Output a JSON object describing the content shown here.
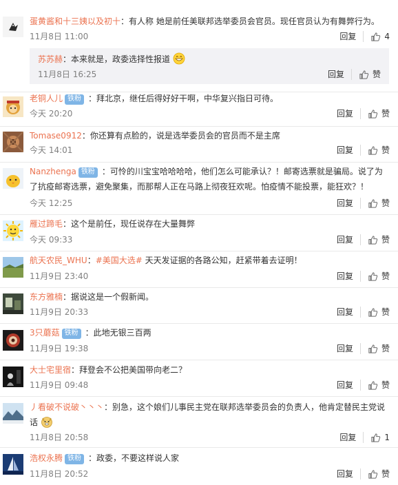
{
  "labels": {
    "reply": "回复",
    "like": "赞",
    "sep": "："
  },
  "colors": {
    "username": "#eb7350",
    "badge_bg": "#7fb5e6",
    "tag": "#eb7350",
    "time": "#808080"
  },
  "comments": [
    {
      "user": "蛋黄酱和十三姨以及初十",
      "badge": "",
      "text": "有人称 她是前任美联邦选举委员会官员。现任官员认为有舞弊行为。",
      "time": "11月8日 11:00",
      "like_count": "4",
      "avatar_icon": "bird-avatar",
      "reply": {
        "user": "苏苏赫",
        "text": "本来就是，政委选择性报道",
        "emoji": "grin-emoji",
        "time": "11月8日 16:25",
        "like_label": "赞"
      }
    },
    {
      "user": "老铜人儿",
      "badge": "铁粉",
      "text": "拜北京，继任后得好好干啊，中华复兴指日可待。",
      "time": "今天 20:20",
      "like_label": "赞",
      "avatar_icon": "monkey-king-avatar"
    },
    {
      "user": "Tomase0912",
      "badge": "",
      "text": "你还算有点脸的，说是选举委员会的官员而不是主席",
      "time": "今天 14:01",
      "like_label": "赞",
      "avatar_icon": "pattern-avatar"
    },
    {
      "user": "Nanzhenga",
      "badge": "铁粉",
      "text": "可怜的川宝宝哈哈哈哈，他们怎么可能承认？！邮寄选票就是骗局。说了为了抗疫邮寄选票，避免聚集，而那帮人正在马路上彻夜狂欢呢。怕疫情不能投票，能狂欢？！",
      "time": "今天 12:25",
      "like_label": "赞",
      "avatar_icon": "chick-avatar"
    },
    {
      "user": "雁过蹄毛",
      "badge": "",
      "text": "这个是前任，现任说存在大量舞弊",
      "time": "今天 09:33",
      "like_label": "赞",
      "avatar_icon": "sun-emoji-avatar"
    },
    {
      "user": "航天农民_WHU",
      "badge": "",
      "tag": "#美国大选#",
      "text": " 天天发证据的各路公知，赶紧带着去证明！",
      "time": "11月9日 23:40",
      "like_label": "赞",
      "avatar_icon": "field-avatar"
    },
    {
      "user": "东方雅楠",
      "badge": "",
      "text": "据说这是一个假新闻。",
      "time": "11月9日 20:33",
      "like_label": "赞",
      "avatar_icon": "room-avatar"
    },
    {
      "user": "3只蘑菇",
      "badge": "铁粉",
      "text": "此地无银三百两",
      "time": "11月9日 19:38",
      "like_label": "赞",
      "avatar_icon": "planet-avatar"
    },
    {
      "user": "大士宅里宿",
      "badge": "",
      "text": "拜登会不公把美国带向老二？",
      "time": "11月9日 09:48",
      "like_label": "赞",
      "avatar_icon": "dark-avatar"
    },
    {
      "user": "丿看破不说破丶丶丶",
      "badge": "",
      "text": "别急，这个娘们儿事民主党在联邦选举委员会的负责人，他肯定替民主党说话",
      "emoji": "doge-emoji",
      "time": "11月8日 20:58",
      "like_count": "1",
      "avatar_icon": "landscape-avatar"
    },
    {
      "user": "浩权永腾",
      "badge": "铁粉",
      "text": "政委，不要这样说人家",
      "time": "11月8日 20:52",
      "like_label": "赞",
      "avatar_icon": "sailboat-avatar"
    }
  ]
}
